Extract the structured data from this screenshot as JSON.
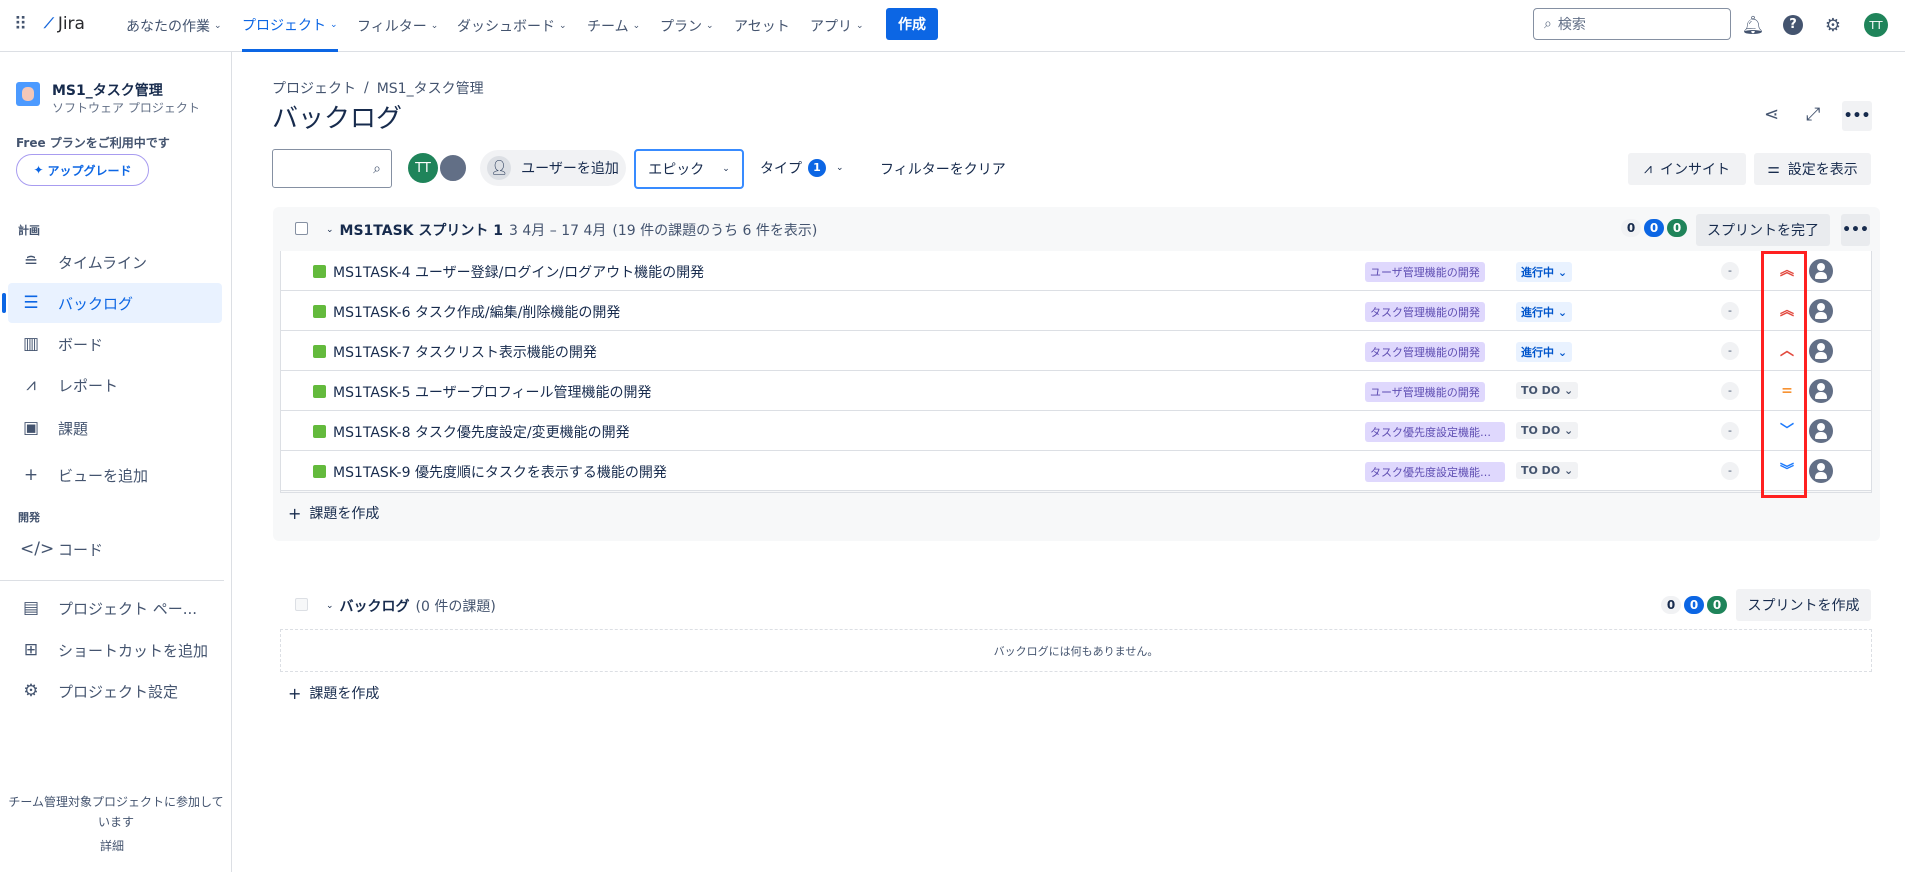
{
  "topnav": {
    "app": "Jira",
    "items": [
      "あなたの作業",
      "プロジェクト",
      "フィルター",
      "ダッシュボード",
      "チーム",
      "プラン",
      "アセット",
      "アプリ"
    ],
    "create": "作成",
    "search_placeholder": "検索",
    "user_initials": "TT"
  },
  "sidebar": {
    "project_name": "MS1_タスク管理",
    "project_type": "ソフトウェア プロジェクト",
    "plan_text": "Free プランをご利用中です",
    "upgrade": "アップグレード",
    "section_plan": "計画",
    "section_dev": "開発",
    "items": [
      "タイムライン",
      "バックログ",
      "ボード",
      "レポート",
      "課題",
      "ビューを追加",
      "コード",
      "プロジェクト ペー...",
      "ショートカットを追加",
      "プロジェクト設定"
    ],
    "footer": "チーム管理対象プロジェクトに参加しています",
    "footer_link": "詳細"
  },
  "breadcrumb": {
    "root": "プロジェクト",
    "sep": "/",
    "project": "MS1_タスク管理"
  },
  "title": "バックログ",
  "toolbar": {
    "add_user": "ユーザーを追加",
    "epic": "エピック",
    "type": "タイプ",
    "type_count": "1",
    "clear": "フィルターをクリア",
    "insight": "インサイト",
    "view_settings": "設定を表示",
    "avatar": "TT"
  },
  "sprint": {
    "name": "MS1TASK スプリント 1",
    "dates": "3 4月 – 17 4月",
    "count_text": "(19 件の課題のうち 6 件を表示)",
    "counts": [
      "0",
      "0",
      "0"
    ],
    "complete": "スプリントを完了",
    "create_issue": "課題を作成",
    "issues": [
      {
        "key": "MS1TASK-4",
        "summary": "ユーザー登録/ログイン/ログアウト機能の開発",
        "epic": "ユーザ管理機能の開発",
        "status": "進行中",
        "estimate": "-",
        "priority": "highest"
      },
      {
        "key": "MS1TASK-6",
        "summary": "タスク作成/編集/削除機能の開発",
        "epic": "タスク管理機能の開発",
        "status": "進行中",
        "estimate": "-",
        "priority": "highest"
      },
      {
        "key": "MS1TASK-7",
        "summary": "タスクリスト表示機能の開発",
        "epic": "タスク管理機能の開発",
        "status": "進行中",
        "estimate": "-",
        "priority": "high"
      },
      {
        "key": "MS1TASK-5",
        "summary": "ユーザープロフィール管理機能の開発",
        "epic": "ユーザ管理機能の開発",
        "status": "TO DO",
        "estimate": "-",
        "priority": "medium"
      },
      {
        "key": "MS1TASK-8",
        "summary": "タスク優先度設定/変更機能の開発",
        "epic": "タスク優先度設定機能の開発",
        "status": "TO DO",
        "estimate": "-",
        "priority": "low"
      },
      {
        "key": "MS1TASK-9",
        "summary": "優先度順にタスクを表示する機能の開発",
        "epic": "タスク優先度設定機能の開発",
        "status": "TO DO",
        "estimate": "-",
        "priority": "lowest"
      }
    ]
  },
  "backlog": {
    "name": "バックログ",
    "count_text": "(0 件の課題)",
    "counts": [
      "0",
      "0",
      "0"
    ],
    "create_sprint": "スプリントを作成",
    "empty": "バックログには何もありません。",
    "create_issue": "課題を作成"
  },
  "colors": {
    "accent": "#0c66e4",
    "highlight": "#ff0000"
  }
}
